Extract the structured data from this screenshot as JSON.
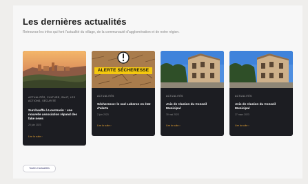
{
  "section": {
    "title": "Les dernières actualités",
    "intro": "Retrouvez les infos qui font l'actualité du village, de la communauté d'agglomération et de notre région."
  },
  "cards": [
    {
      "category": "ACTUALITÉS, CULTURE, SAUT, LES ACTIONS, SÉCURITÉ",
      "title": "Surchauffe à Lourmarin : une nouvelle association répand des fake news",
      "date": "20 juin 2023",
      "more": "Lire la suite"
    },
    {
      "category": "ACTUALITÉS",
      "title": "Sécheresse: le sud Luberon en état d'alerte",
      "date": "2 juin 2023",
      "more": "Lire la suite",
      "image_label": "ALERTE SÉCHERESSE"
    },
    {
      "category": "ACTUALITÉS",
      "title": "Avis de réunion du Conseil Municipal",
      "date": "30 mai 2023",
      "more": "Lire la suite"
    },
    {
      "category": "ACTUALITÉS",
      "title": "Avis de réunion du Conseil Municipal",
      "date": "27 mars 2023",
      "more": "Lire la suite"
    }
  ],
  "all_news_button": "Toutes l'actualités",
  "colors": {
    "card_bg": "#1c1d22",
    "accent": "#e7a435",
    "alert_yellow": "#f5c90f"
  }
}
